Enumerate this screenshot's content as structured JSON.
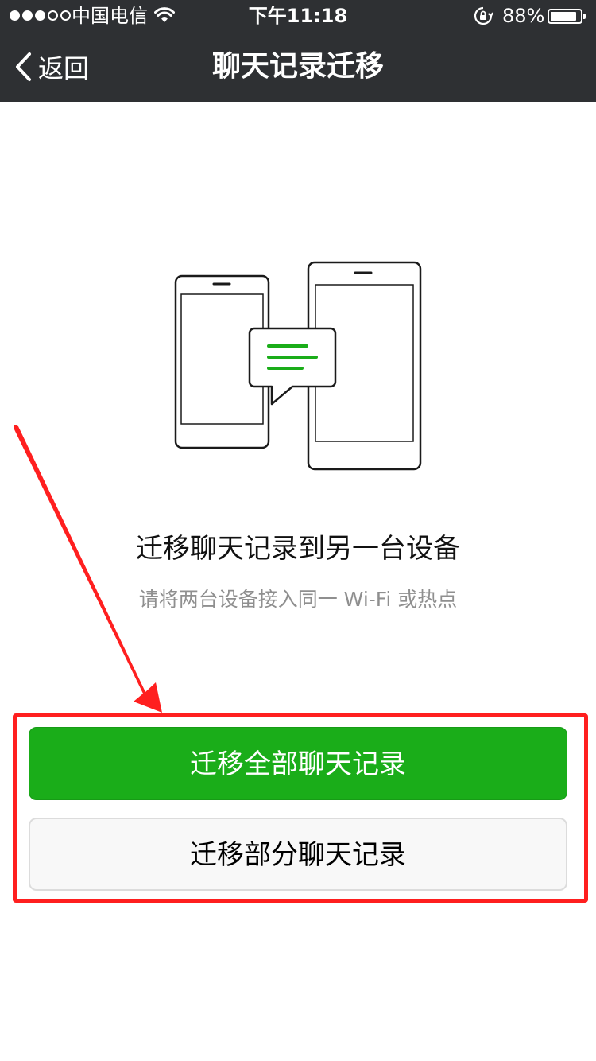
{
  "status_bar": {
    "carrier": "中国电信",
    "time": "下午11:18",
    "battery_percent": "88%",
    "battery_level": 0.88,
    "signal_strength": 3,
    "signal_max": 5,
    "icons": [
      "signal-dots-icon",
      "wifi-icon",
      "rotation-lock-icon",
      "battery-icon"
    ]
  },
  "nav": {
    "back_label": "返回",
    "title": "聊天记录迁移"
  },
  "content": {
    "headline": "迁移聊天记录到另一台设备",
    "subline": "请将两台设备接入同一 Wi-Fi 或热点",
    "illustration_icon": "two-phones-chat-transfer-icon"
  },
  "actions": {
    "migrate_all": "迁移全部聊天记录",
    "migrate_partial": "迁移部分聊天记录"
  },
  "colors": {
    "nav_background": "#2e3033",
    "primary_green": "#1aad19",
    "annotation_red": "#ff1f1f"
  }
}
